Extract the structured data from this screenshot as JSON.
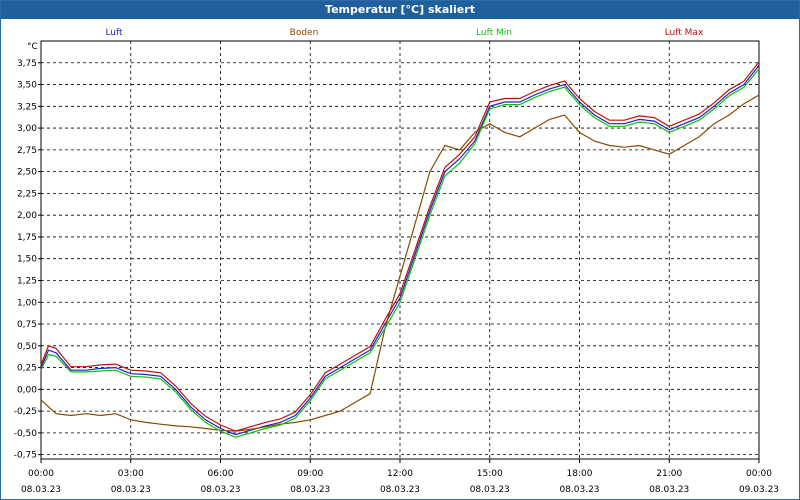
{
  "window": {
    "title": "Temperatur [°C] skaliert"
  },
  "chart_data": {
    "type": "line",
    "title": "Temperatur [°C] skaliert",
    "ylabel": "°C",
    "xlabel": "",
    "ylim": [
      -0.8,
      4.0
    ],
    "y_ticks": [
      -0.75,
      -0.5,
      -0.25,
      0.0,
      0.25,
      0.5,
      0.75,
      1.0,
      1.25,
      1.5,
      1.75,
      2.0,
      2.25,
      2.5,
      2.75,
      3.0,
      3.25,
      3.5,
      3.75
    ],
    "y_tick_labels": [
      "-0,75",
      "-0,50",
      "-0,25",
      "0,00",
      "0,25",
      "0,50",
      "0,75",
      "1,00",
      "1,25",
      "1,50",
      "1,75",
      "2,00",
      "2,25",
      "2,50",
      "2,75",
      "3,00",
      "3,25",
      "3,50",
      "3,75"
    ],
    "x_ticks": [
      {
        "time": "00:00",
        "date": "08.03.23"
      },
      {
        "time": "03:00",
        "date": "08.03.23"
      },
      {
        "time": "06:00",
        "date": "08.03.23"
      },
      {
        "time": "09:00",
        "date": "08.03.23"
      },
      {
        "time": "12:00",
        "date": "08.03.23"
      },
      {
        "time": "15:00",
        "date": "08.03.23"
      },
      {
        "time": "18:00",
        "date": "08.03.23"
      },
      {
        "time": "21:00",
        "date": "08.03.23"
      },
      {
        "time": "00:00",
        "date": "09.03.23"
      }
    ],
    "grid": true,
    "legend_position": "top",
    "series": [
      {
        "name": "Luft",
        "color": "#2020c8",
        "points": [
          [
            0,
            0.25
          ],
          [
            0.25,
            0.45
          ],
          [
            0.5,
            0.42
          ],
          [
            1,
            0.22
          ],
          [
            1.5,
            0.22
          ],
          [
            2,
            0.24
          ],
          [
            2.5,
            0.25
          ],
          [
            3,
            0.18
          ],
          [
            3.5,
            0.17
          ],
          [
            4,
            0.15
          ],
          [
            4.5,
            0.0
          ],
          [
            5,
            -0.2
          ],
          [
            5.5,
            -0.35
          ],
          [
            6,
            -0.45
          ],
          [
            6.5,
            -0.52
          ],
          [
            7,
            -0.47
          ],
          [
            7.5,
            -0.42
          ],
          [
            8,
            -0.38
          ],
          [
            8.5,
            -0.3
          ],
          [
            9,
            -0.1
          ],
          [
            9.5,
            0.15
          ],
          [
            10,
            0.25
          ],
          [
            10.5,
            0.35
          ],
          [
            11,
            0.45
          ],
          [
            11.5,
            0.75
          ],
          [
            12,
            1.05
          ],
          [
            12.5,
            1.55
          ],
          [
            13,
            2.05
          ],
          [
            13.5,
            2.5
          ],
          [
            14,
            2.65
          ],
          [
            14.5,
            2.85
          ],
          [
            15,
            3.25
          ],
          [
            15.5,
            3.3
          ],
          [
            16,
            3.3
          ],
          [
            16.5,
            3.38
          ],
          [
            17,
            3.45
          ],
          [
            17.5,
            3.5
          ],
          [
            18,
            3.3
          ],
          [
            18.5,
            3.15
          ],
          [
            19,
            3.05
          ],
          [
            19.5,
            3.05
          ],
          [
            20,
            3.1
          ],
          [
            20.5,
            3.08
          ],
          [
            21,
            2.98
          ],
          [
            21.5,
            3.05
          ],
          [
            22,
            3.12
          ],
          [
            22.5,
            3.25
          ],
          [
            23,
            3.4
          ],
          [
            23.5,
            3.5
          ],
          [
            24,
            3.72
          ]
        ]
      },
      {
        "name": "Boden",
        "color": "#8a4a00",
        "points": [
          [
            0,
            -0.12
          ],
          [
            0.5,
            -0.28
          ],
          [
            1,
            -0.3
          ],
          [
            1.5,
            -0.28
          ],
          [
            2,
            -0.3
          ],
          [
            2.5,
            -0.28
          ],
          [
            3,
            -0.35
          ],
          [
            3.5,
            -0.38
          ],
          [
            4,
            -0.4
          ],
          [
            4.5,
            -0.42
          ],
          [
            5,
            -0.43
          ],
          [
            5.5,
            -0.45
          ],
          [
            6,
            -0.47
          ],
          [
            6.5,
            -0.48
          ],
          [
            7,
            -0.46
          ],
          [
            7.5,
            -0.43
          ],
          [
            8,
            -0.4
          ],
          [
            8.5,
            -0.38
          ],
          [
            9,
            -0.35
          ],
          [
            9.5,
            -0.3
          ],
          [
            10,
            -0.25
          ],
          [
            10.5,
            -0.15
          ],
          [
            11,
            -0.05
          ],
          [
            11.5,
            0.7
          ],
          [
            12,
            1.3
          ],
          [
            12.5,
            1.9
          ],
          [
            13,
            2.5
          ],
          [
            13.5,
            2.8
          ],
          [
            14,
            2.75
          ],
          [
            14.5,
            2.95
          ],
          [
            15,
            3.05
          ],
          [
            15.5,
            2.95
          ],
          [
            16,
            2.9
          ],
          [
            16.5,
            3.0
          ],
          [
            17,
            3.1
          ],
          [
            17.5,
            3.15
          ],
          [
            18,
            2.95
          ],
          [
            18.5,
            2.85
          ],
          [
            19,
            2.8
          ],
          [
            19.5,
            2.78
          ],
          [
            20,
            2.8
          ],
          [
            20.5,
            2.75
          ],
          [
            21,
            2.7
          ],
          [
            21.5,
            2.8
          ],
          [
            22,
            2.9
          ],
          [
            22.5,
            3.05
          ],
          [
            23,
            3.15
          ],
          [
            23.5,
            3.28
          ],
          [
            24,
            3.38
          ]
        ]
      },
      {
        "name": "Luft Min",
        "color": "#10c010",
        "points": [
          [
            0,
            0.22
          ],
          [
            0.25,
            0.4
          ],
          [
            0.5,
            0.38
          ],
          [
            1,
            0.2
          ],
          [
            1.5,
            0.2
          ],
          [
            2,
            0.21
          ],
          [
            2.5,
            0.22
          ],
          [
            3,
            0.15
          ],
          [
            3.5,
            0.14
          ],
          [
            4,
            0.12
          ],
          [
            4.5,
            -0.03
          ],
          [
            5,
            -0.23
          ],
          [
            5.5,
            -0.38
          ],
          [
            6,
            -0.48
          ],
          [
            6.5,
            -0.55
          ],
          [
            7,
            -0.5
          ],
          [
            7.5,
            -0.45
          ],
          [
            8,
            -0.41
          ],
          [
            8.5,
            -0.33
          ],
          [
            9,
            -0.13
          ],
          [
            9.5,
            0.12
          ],
          [
            10,
            0.22
          ],
          [
            10.5,
            0.32
          ],
          [
            11,
            0.42
          ],
          [
            11.5,
            0.7
          ],
          [
            12,
            1.0
          ],
          [
            12.5,
            1.5
          ],
          [
            13,
            2.0
          ],
          [
            13.5,
            2.45
          ],
          [
            14,
            2.6
          ],
          [
            14.5,
            2.82
          ],
          [
            15,
            3.22
          ],
          [
            15.5,
            3.27
          ],
          [
            16,
            3.27
          ],
          [
            16.5,
            3.35
          ],
          [
            17,
            3.42
          ],
          [
            17.5,
            3.47
          ],
          [
            18,
            3.27
          ],
          [
            18.5,
            3.12
          ],
          [
            19,
            3.02
          ],
          [
            19.5,
            3.02
          ],
          [
            20,
            3.07
          ],
          [
            20.5,
            3.05
          ],
          [
            21,
            2.95
          ],
          [
            21.5,
            3.02
          ],
          [
            22,
            3.09
          ],
          [
            22.5,
            3.22
          ],
          [
            23,
            3.37
          ],
          [
            23.5,
            3.47
          ],
          [
            24,
            3.68
          ]
        ]
      },
      {
        "name": "Luft Max",
        "color": "#c01010",
        "points": [
          [
            0,
            0.28
          ],
          [
            0.25,
            0.5
          ],
          [
            0.5,
            0.47
          ],
          [
            1,
            0.26
          ],
          [
            1.5,
            0.26
          ],
          [
            2,
            0.28
          ],
          [
            2.5,
            0.29
          ],
          [
            3,
            0.22
          ],
          [
            3.5,
            0.21
          ],
          [
            4,
            0.19
          ],
          [
            4.5,
            0.04
          ],
          [
            5,
            -0.16
          ],
          [
            5.5,
            -0.31
          ],
          [
            6,
            -0.41
          ],
          [
            6.5,
            -0.48
          ],
          [
            7,
            -0.43
          ],
          [
            7.5,
            -0.38
          ],
          [
            8,
            -0.34
          ],
          [
            8.5,
            -0.26
          ],
          [
            9,
            -0.06
          ],
          [
            9.5,
            0.19
          ],
          [
            10,
            0.29
          ],
          [
            10.5,
            0.39
          ],
          [
            11,
            0.49
          ],
          [
            11.5,
            0.8
          ],
          [
            12,
            1.1
          ],
          [
            12.5,
            1.6
          ],
          [
            13,
            2.1
          ],
          [
            13.5,
            2.55
          ],
          [
            14,
            2.7
          ],
          [
            14.5,
            2.9
          ],
          [
            15,
            3.3
          ],
          [
            15.5,
            3.34
          ],
          [
            16,
            3.34
          ],
          [
            16.5,
            3.42
          ],
          [
            17,
            3.49
          ],
          [
            17.5,
            3.54
          ],
          [
            18,
            3.34
          ],
          [
            18.5,
            3.19
          ],
          [
            19,
            3.09
          ],
          [
            19.5,
            3.09
          ],
          [
            20,
            3.14
          ],
          [
            20.5,
            3.12
          ],
          [
            21,
            3.02
          ],
          [
            21.5,
            3.09
          ],
          [
            22,
            3.16
          ],
          [
            22.5,
            3.29
          ],
          [
            23,
            3.44
          ],
          [
            23.5,
            3.54
          ],
          [
            24,
            3.76
          ]
        ]
      }
    ]
  }
}
